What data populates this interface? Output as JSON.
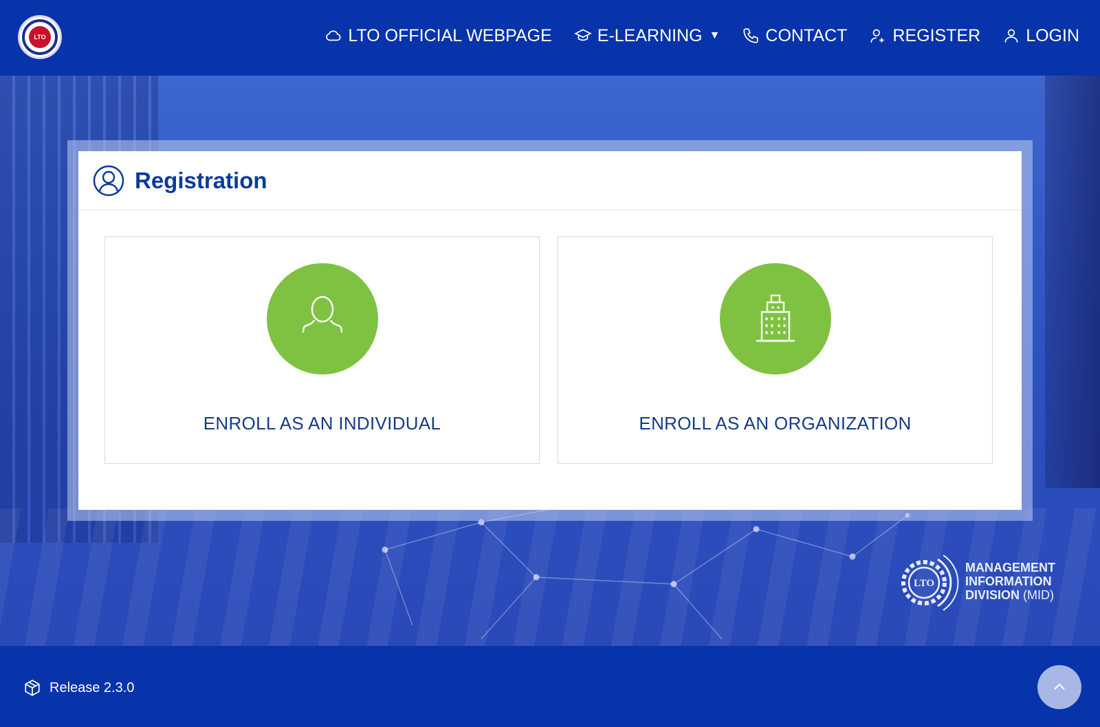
{
  "header": {
    "logo_icon": "lto-seal-logo",
    "logo_text": "LTO",
    "nav": [
      {
        "label": "LTO OFFICIAL WEBPAGE",
        "icon": "cloud-icon"
      },
      {
        "label": "E-LEARNING",
        "icon": "graduation-cap-icon",
        "dropdown": true
      },
      {
        "label": "CONTACT",
        "icon": "phone-icon"
      },
      {
        "label": "REGISTER",
        "icon": "user-plus-icon"
      },
      {
        "label": "LOGIN",
        "icon": "user-icon"
      }
    ]
  },
  "registration": {
    "title": "Registration",
    "options": [
      {
        "label": "ENROLL AS AN INDIVIDUAL",
        "icon": "person-icon"
      },
      {
        "label": "ENROLL AS AN ORGANIZATION",
        "icon": "building-icon"
      }
    ]
  },
  "mid_logo": {
    "badge": "LTO",
    "line1": "MANAGEMENT",
    "line2": "INFORMATION",
    "line3": "DIVISION",
    "line3_suffix": "(MID)"
  },
  "footer": {
    "release": "Release 2.3.0"
  },
  "colors": {
    "brand_blue": "#0733ab",
    "accent_green": "#7fc241",
    "title_blue": "#0c3a9c",
    "label_blue": "#163b86"
  }
}
